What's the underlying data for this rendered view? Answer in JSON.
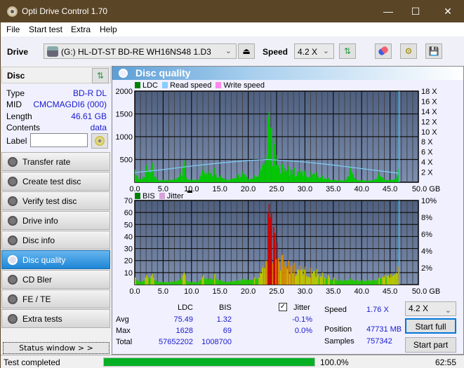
{
  "window": {
    "title": "Opti Drive Control 1.70",
    "controls": {
      "minimize": "—",
      "maximize": "☐",
      "close": "✕"
    }
  },
  "menu": [
    "File",
    "Start test",
    "Extra",
    "Help"
  ],
  "toolbar": {
    "drive_label": "Drive",
    "drive_value": "(G:)  HL-DT-ST BD-RE  WH16NS48 1.D3",
    "speed_label": "Speed",
    "speed_value": "4.2 X",
    "icons": [
      "eject-icon",
      "refresh-icon",
      "erase-icon",
      "settings-icon",
      "save-icon"
    ]
  },
  "disc": {
    "header": "Disc",
    "fields": [
      {
        "label": "Type",
        "value": "BD-R DL"
      },
      {
        "label": "MID",
        "value": "CMCMAGDI6 (000)"
      },
      {
        "label": "Length",
        "value": "46.61 GB"
      },
      {
        "label": "Contents",
        "value": "data"
      }
    ],
    "label_field_label": "Label",
    "label_value": ""
  },
  "nav": [
    {
      "label": "Transfer rate",
      "active": false
    },
    {
      "label": "Create test disc",
      "active": false
    },
    {
      "label": "Verify test disc",
      "active": false
    },
    {
      "label": "Drive info",
      "active": false
    },
    {
      "label": "Disc info",
      "active": false
    },
    {
      "label": "Disc quality",
      "active": true
    },
    {
      "label": "CD Bler",
      "active": false
    },
    {
      "label": "FE / TE",
      "active": false
    },
    {
      "label": "Extra tests",
      "active": false
    }
  ],
  "status_window_button": "Status window > >",
  "panel_title": "Disc quality",
  "colors": {
    "ldc": "#00c800",
    "read_speed": "#7ec8f0",
    "write_speed": "#ff88ee",
    "bis": "#00c800",
    "jitter": "#d8a0d8",
    "plot_bg_top": "#4e5f80",
    "plot_bg_bottom": "#7d8fb0",
    "accent_active": "#1e86d6",
    "progress": "#06b025"
  },
  "chart_data": [
    {
      "type": "bar",
      "title": "LDC / Read speed",
      "legend": [
        "LDC",
        "Read speed",
        "Write speed"
      ],
      "legend_position": "top-left",
      "xlabel": "GB",
      "x_ticks": [
        "0.0",
        "5.0",
        "10.0",
        "15.0",
        "20.0",
        "25.0",
        "30.0",
        "35.0",
        "40.0",
        "45.0",
        "50.0 GB"
      ],
      "xlim": [
        0,
        50
      ],
      "y_left_ticks": [
        "500",
        "1000",
        "1500",
        "2000"
      ],
      "ylim_left": [
        0,
        2000
      ],
      "y_right_ticks": [
        "2 X",
        "4 X",
        "6 X",
        "8 X",
        "10 X",
        "12 X",
        "14 X",
        "16 X",
        "18 X"
      ],
      "ylim_right": [
        0,
        18
      ],
      "grid": true,
      "series": [
        {
          "name": "LDC",
          "x": [
            0,
            1,
            2,
            3,
            4,
            5,
            6,
            7,
            8,
            8.7,
            9,
            10,
            11,
            12,
            13,
            14,
            15,
            16,
            17,
            18,
            19,
            20,
            21,
            22,
            22.5,
            23,
            23.5,
            24,
            24.5,
            25,
            26,
            27,
            28,
            29,
            30,
            31,
            32,
            33,
            34,
            35,
            36,
            37,
            38,
            39,
            40,
            41,
            42,
            43,
            44,
            45,
            46,
            46.6
          ],
          "values": [
            280,
            60,
            380,
            420,
            40,
            60,
            50,
            80,
            200,
            520,
            100,
            60,
            60,
            360,
            250,
            320,
            150,
            60,
            80,
            200,
            250,
            60,
            150,
            300,
            400,
            600,
            1628,
            1200,
            900,
            600,
            400,
            350,
            320,
            300,
            280,
            250,
            220,
            150,
            100,
            60,
            50,
            40,
            350,
            60,
            50,
            40,
            40,
            220,
            50,
            50,
            80,
            420
          ]
        },
        {
          "name": "Read speed",
          "x": [
            0,
            5,
            10,
            15,
            20,
            23.5,
            25,
            30,
            35,
            40,
            45,
            46.6
          ],
          "values": [
            1.9,
            2.5,
            3.2,
            3.8,
            4.3,
            4.5,
            4.4,
            4.0,
            3.4,
            2.7,
            2.0,
            1.76
          ]
        },
        {
          "name": "Write speed",
          "x": [],
          "values": []
        }
      ]
    },
    {
      "type": "bar",
      "title": "BIS / Jitter",
      "legend": [
        "BIS",
        "Jitter"
      ],
      "legend_position": "top-left",
      "xlabel": "GB",
      "x_ticks": [
        "0.0",
        "5.0",
        "10.0",
        "15.0",
        "20.0",
        "25.0",
        "30.0",
        "35.0",
        "40.0",
        "45.0",
        "50.0 GB"
      ],
      "xlim": [
        0,
        50
      ],
      "y_left_ticks": [
        "10",
        "20",
        "30",
        "40",
        "50",
        "60",
        "70"
      ],
      "ylim_left": [
        0,
        70
      ],
      "y_right_ticks": [
        "2%",
        "4%",
        "6%",
        "8%",
        "10%"
      ],
      "ylim_right": [
        0,
        10
      ],
      "grid": true,
      "series": [
        {
          "name": "BIS",
          "x": [
            0,
            1,
            2,
            3,
            4,
            5,
            6,
            7,
            8,
            8.7,
            9,
            10,
            11,
            12,
            13,
            14,
            15,
            16,
            17,
            18,
            19,
            20,
            21,
            22,
            22.5,
            23,
            23.5,
            24,
            24.5,
            25,
            26,
            27,
            28,
            29,
            30,
            31,
            32,
            33,
            34,
            35,
            36,
            37,
            38,
            39,
            40,
            41,
            42,
            43,
            44,
            45,
            46,
            46.6
          ],
          "values": [
            6,
            2,
            8,
            9,
            2,
            2,
            2,
            3,
            5,
            11,
            3,
            2,
            2,
            8,
            5,
            9,
            4,
            2,
            3,
            4,
            5,
            4,
            6,
            10,
            15,
            20,
            69,
            60,
            45,
            35,
            25,
            20,
            18,
            16,
            15,
            14,
            13,
            10,
            8,
            6,
            5,
            4,
            5,
            4,
            4,
            4,
            4,
            6,
            8,
            9,
            10,
            20
          ]
        },
        {
          "name": "Jitter",
          "x": [],
          "values": []
        }
      ]
    }
  ],
  "stats": {
    "col_headers": [
      "LDC",
      "BIS"
    ],
    "rows": [
      {
        "label": "Avg",
        "ldc": "75.49",
        "bis": "1.32"
      },
      {
        "label": "Max",
        "ldc": "1628",
        "bis": "69"
      },
      {
        "label": "Total",
        "ldc": "57652202",
        "bis": "1008700"
      }
    ],
    "jitter_label": "Jitter",
    "jitter_checked": true,
    "jitter_avg": "-0.1%",
    "jitter_max": "0.0%",
    "speed_label": "Speed",
    "speed_value": "1.76 X",
    "position_label": "Position",
    "position_value": "47731 MB",
    "samples_label": "Samples",
    "samples_value": "757342",
    "speed_select": "4.2 X",
    "start_full": "Start full",
    "start_part": "Start part"
  },
  "statusbar": {
    "text": "Test completed",
    "progress_percent": 100,
    "progress_label": "100.0%",
    "time": "62:55"
  }
}
